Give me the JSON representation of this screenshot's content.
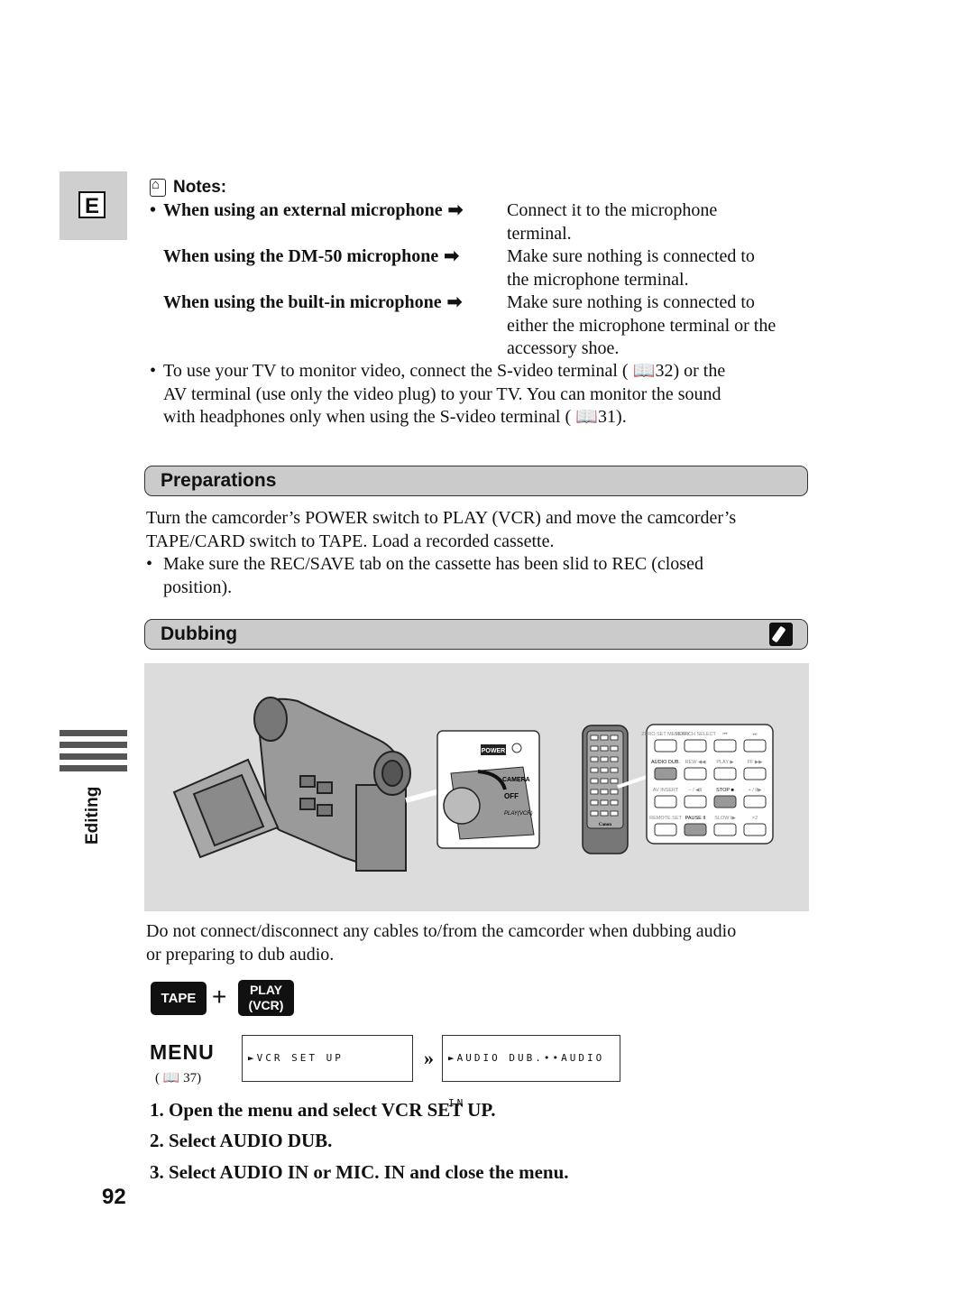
{
  "page": {
    "language_tab": "E",
    "side_index_label": "Editing",
    "page_number": "92"
  },
  "notes": {
    "title": "Notes:",
    "rows": [
      {
        "bullet": "•",
        "condition": "When using an external microphone",
        "arrow": "➡",
        "action_lines": [
          "Connect it to the microphone",
          "terminal."
        ]
      },
      {
        "bullet": "",
        "condition": "When using the DM-50 microphone",
        "arrow": "➡",
        "action_lines": [
          "Make sure nothing is connected to",
          "the microphone terminal."
        ]
      },
      {
        "bullet": "",
        "condition": "When using the built-in microphone",
        "arrow": "➡",
        "action_lines": [
          "Make sure nothing is connected to",
          "either the microphone terminal or the",
          "accessory shoe."
        ]
      }
    ],
    "tv_note": {
      "bullet": "•",
      "lines": [
        "To use your TV to monitor video, connect the S-video terminal ( 📖32) or the",
        "AV terminal (use only the video plug) to your TV. You can monitor the sound",
        "with headphones only when using the S-video terminal ( 📖31)."
      ]
    }
  },
  "preparations": {
    "title": "Preparations",
    "lines": [
      "Turn the camcorder’s POWER switch to PLAY (VCR) and move the camcorder’s",
      "TAPE/CARD switch to TAPE. Load a recorded cassette."
    ],
    "bullet": "•",
    "bullet_lines": [
      "Make sure the REC/SAVE tab on the cassette has been slid to REC (closed",
      "position)."
    ]
  },
  "dubbing": {
    "title": "Dubbing",
    "header_icon": "remote-control-icon",
    "illustration": {
      "power_label": "POWER",
      "switch_positions": [
        "CAMERA",
        "OFF",
        "PLAY(VCR)"
      ],
      "remote_brand": "Canon",
      "remote_buttons": [
        [
          "ZERO SET MEMORY",
          "SEARCH SELECT",
          "⏮",
          "⏭"
        ],
        [
          "AUDIO DUB.",
          "REW ◀◀",
          "PLAY ▶",
          "FF ▶▶"
        ],
        [
          "AV INSERT",
          "– / ◀II",
          "STOP ■",
          "+ / II▶"
        ],
        [
          "REMOTE SET",
          "PAUSE II",
          "SLOW I▶",
          "×2"
        ]
      ]
    },
    "warning_lines": [
      "Do not connect/disconnect any cables to/from the camcorder when dubbing audio",
      "or preparing to dub audio."
    ],
    "mode": {
      "tape": "TAPE",
      "plus": "+",
      "play_line1": "PLAY",
      "play_line2": "(VCR)"
    },
    "menu": {
      "label": "MENU",
      "ref": "( 📖 37)",
      "box1": "►VCR SET UP",
      "box2": "►AUDIO DUB.••AUDIO IN"
    },
    "steps": [
      "1.  Open the menu and select VCR SET UP.",
      "2.  Select AUDIO DUB.",
      "3.  Select AUDIO IN or MIC. IN and close the menu."
    ]
  }
}
